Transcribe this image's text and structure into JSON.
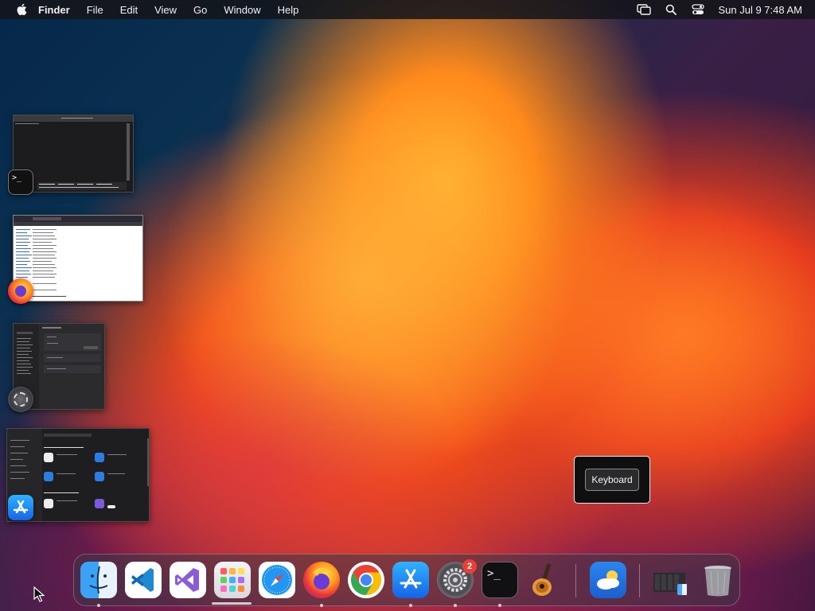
{
  "menubar": {
    "app_name": "Finder",
    "items": [
      "File",
      "Edit",
      "View",
      "Go",
      "Window",
      "Help"
    ],
    "clock": "Sun Jul 9  7:48 AM",
    "icons": [
      "screen-mirroring-icon",
      "search-icon",
      "control-center-icon"
    ]
  },
  "expose": {
    "windows": [
      {
        "app": "Terminal",
        "icon": "terminal-icon"
      },
      {
        "app": "Firefox",
        "icon": "firefox-icon"
      },
      {
        "app": "System Settings",
        "icon": "system-settings-icon"
      },
      {
        "app": "App Store",
        "icon": "app-store-icon"
      }
    ]
  },
  "tooltip": {
    "label": "Keyboard"
  },
  "dock": {
    "items": [
      {
        "name": "Finder",
        "icon": "finder-icon",
        "running": true
      },
      {
        "name": "Visual Studio Code",
        "icon": "vscode-icon",
        "running": false
      },
      {
        "name": "Visual Studio",
        "icon": "visual-studio-icon",
        "running": false
      },
      {
        "name": "Launchpad",
        "icon": "launchpad-icon",
        "running": false
      },
      {
        "name": "Safari",
        "icon": "safari-icon",
        "running": false
      },
      {
        "name": "Firefox",
        "icon": "firefox-icon",
        "running": true
      },
      {
        "name": "Google Chrome",
        "icon": "chrome-icon",
        "running": false
      },
      {
        "name": "App Store",
        "icon": "app-store-icon",
        "running": true
      },
      {
        "name": "System Settings",
        "icon": "system-settings-icon",
        "running": true,
        "badge": "2"
      },
      {
        "name": "Terminal",
        "icon": "terminal-icon",
        "running": true
      },
      {
        "name": "GarageBand",
        "icon": "garageband-icon",
        "running": false
      },
      {
        "name": "Weather",
        "icon": "weather-icon",
        "running": false
      },
      {
        "name": "Downloads Stack",
        "icon": "stack-folder-icon",
        "running": false
      },
      {
        "name": "Trash",
        "icon": "trash-icon",
        "running": false
      }
    ]
  },
  "colors": {
    "menubar_bg": "#141419",
    "badge_red": "#e84035",
    "wallpaper_orange": "#ff8a1c",
    "wallpaper_navy": "#06284a"
  }
}
